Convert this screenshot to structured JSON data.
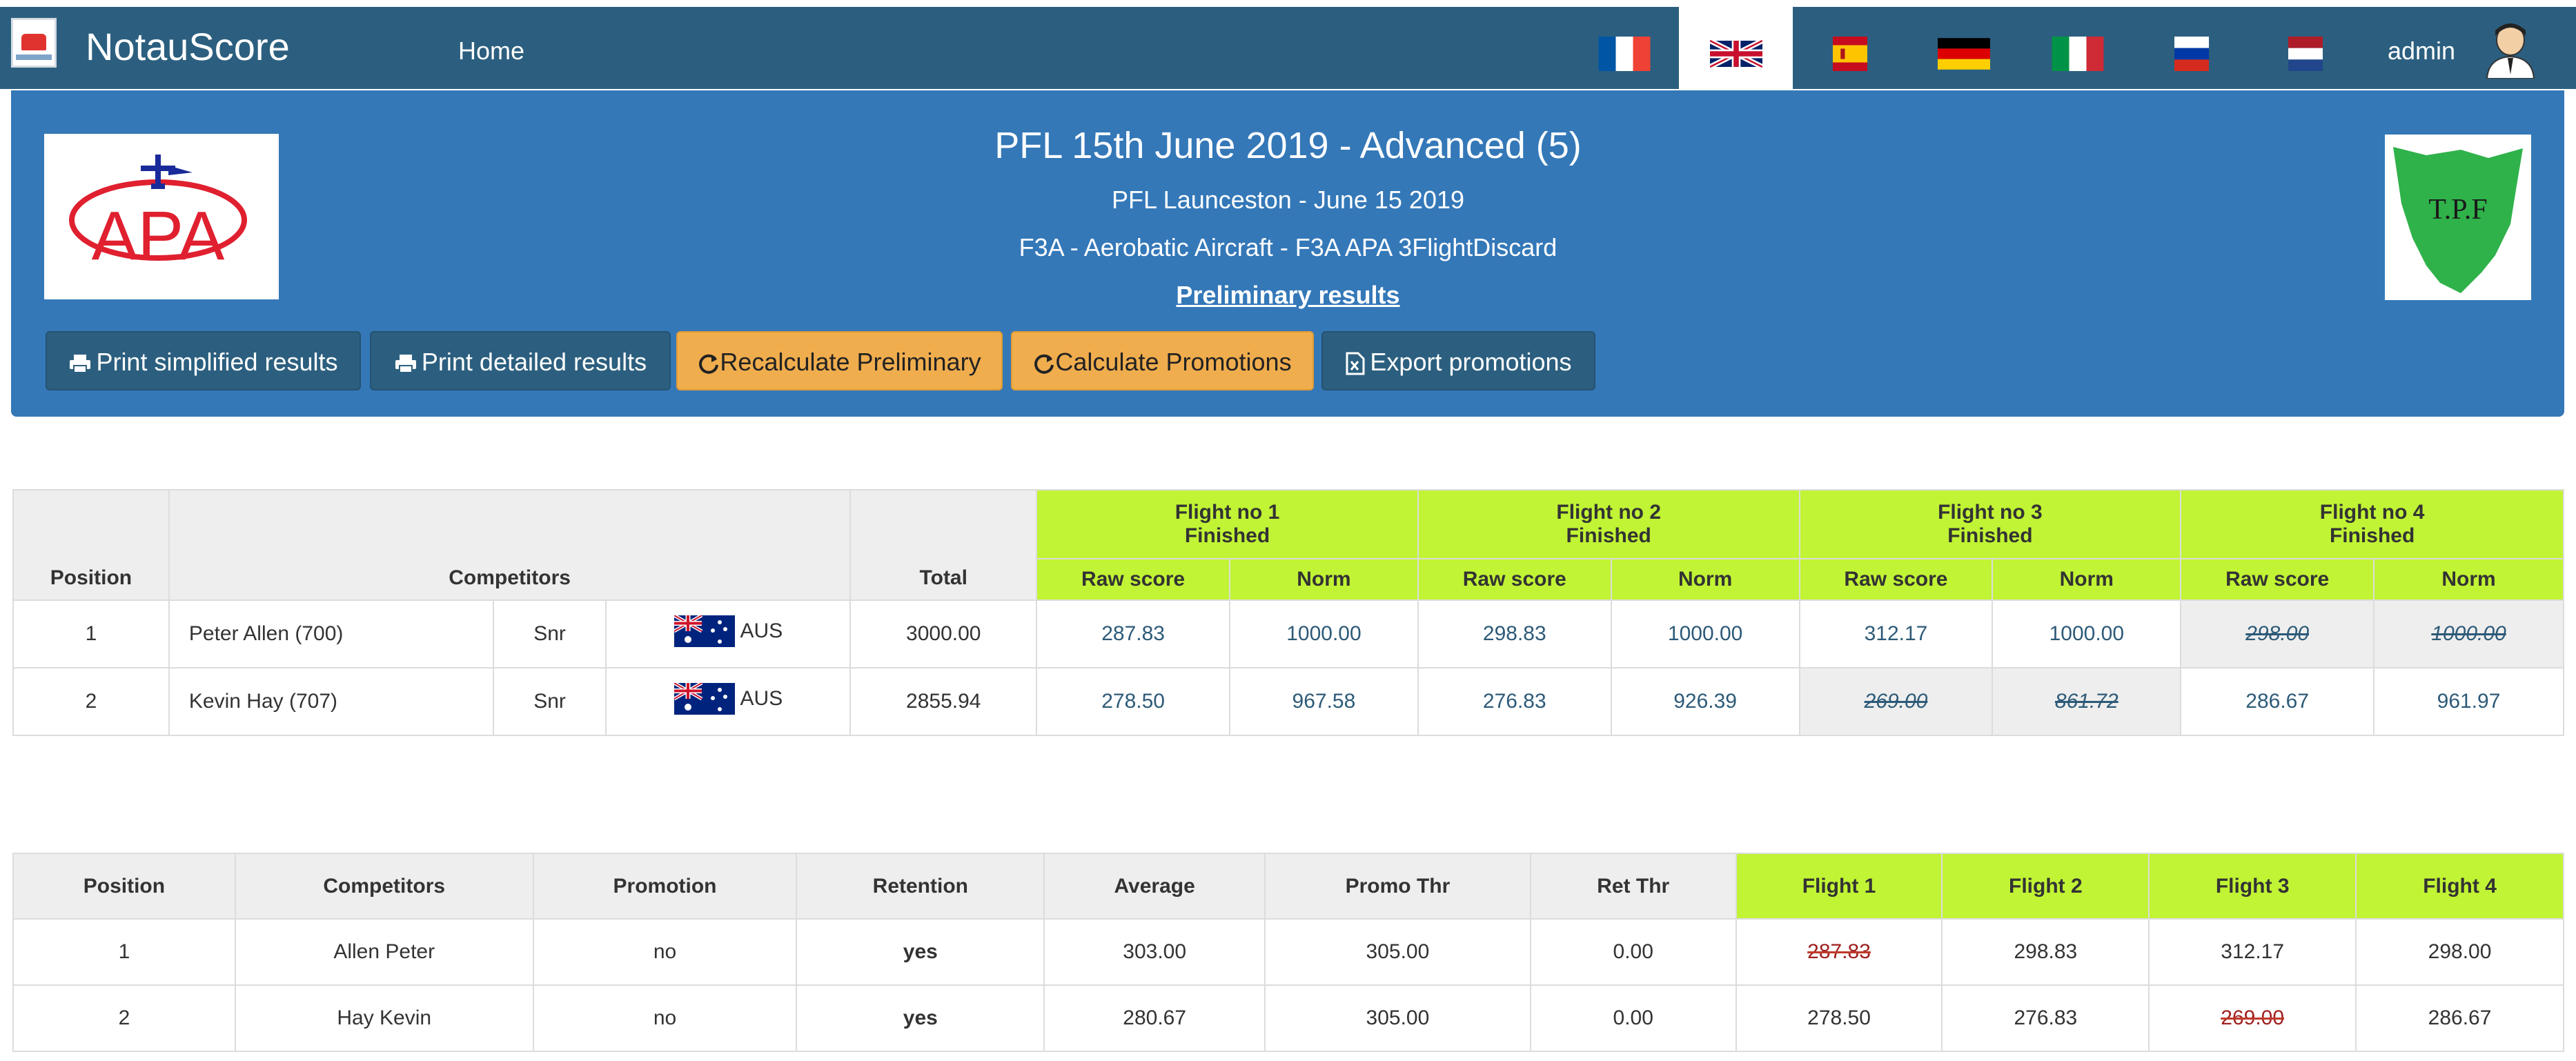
{
  "navbar": {
    "brand": "NotauScore",
    "home": "Home",
    "user": "admin",
    "flags": [
      "fr-flag-icon",
      "uk-flag-icon",
      "es-flag-icon",
      "de-flag-icon",
      "it-flag-icon",
      "ru-flag-icon",
      "nl-flag-icon"
    ],
    "active_flag": "uk-flag-icon"
  },
  "event": {
    "title": "PFL 15th June 2019 - Advanced (5)",
    "subtitle": "PFL Launceston - June 15 2019",
    "class": "F3A - Aerobatic Aircraft - F3A APA 3FlightDiscard",
    "preliminary": "Preliminary results",
    "left_logo_text": "APA",
    "right_logo_text": "T.P.F"
  },
  "buttons": {
    "print_simplified": "Print simplified results",
    "print_detailed": "Print detailed results",
    "recalc": "Recalculate Preliminary",
    "calc_promotions": "Calculate Promotions",
    "export_promotions": "Export promotions"
  },
  "results": {
    "headers": {
      "position": "Position",
      "competitors": "Competitors",
      "total": "Total",
      "raw": "Raw score",
      "norm": "Norm"
    },
    "flights": [
      {
        "name": "Flight no 1",
        "status": "Finished"
      },
      {
        "name": "Flight no 2",
        "status": "Finished"
      },
      {
        "name": "Flight no 3",
        "status": "Finished"
      },
      {
        "name": "Flight no 4",
        "status": "Finished"
      }
    ],
    "rows": [
      {
        "position": "1",
        "name": "Peter Allen (700)",
        "category": "Snr",
        "country": "AUS",
        "total": "3000.00",
        "scores": [
          {
            "raw": "287.83",
            "norm": "1000.00",
            "discarded": false
          },
          {
            "raw": "298.83",
            "norm": "1000.00",
            "discarded": false
          },
          {
            "raw": "312.17",
            "norm": "1000.00",
            "discarded": false
          },
          {
            "raw": "298.00",
            "norm": "1000.00",
            "discarded": true
          }
        ]
      },
      {
        "position": "2",
        "name": "Kevin Hay (707)",
        "category": "Snr",
        "country": "AUS",
        "total": "2855.94",
        "scores": [
          {
            "raw": "278.50",
            "norm": "967.58",
            "discarded": false
          },
          {
            "raw": "276.83",
            "norm": "926.39",
            "discarded": false
          },
          {
            "raw": "269.00",
            "norm": "861.72",
            "discarded": true
          },
          {
            "raw": "286.67",
            "norm": "961.97",
            "discarded": false
          }
        ]
      }
    ]
  },
  "promotions": {
    "headers": [
      "Position",
      "Competitors",
      "Promotion",
      "Retention",
      "Average",
      "Promo Thr",
      "Ret Thr",
      "Flight 1",
      "Flight 2",
      "Flight 3",
      "Flight 4"
    ],
    "rows": [
      {
        "position": "1",
        "name": "Allen Peter",
        "promotion": "no",
        "retention": "yes",
        "average": "303.00",
        "promo_thr": "305.00",
        "ret_thr": "0.00",
        "flights": [
          {
            "v": "287.83",
            "struck": true
          },
          {
            "v": "298.83",
            "struck": false
          },
          {
            "v": "312.17",
            "struck": false
          },
          {
            "v": "298.00",
            "struck": false
          }
        ]
      },
      {
        "position": "2",
        "name": "Hay Kevin",
        "promotion": "no",
        "retention": "yes",
        "average": "280.67",
        "promo_thr": "305.00",
        "ret_thr": "0.00",
        "flights": [
          {
            "v": "278.50",
            "struck": false
          },
          {
            "v": "276.83",
            "struck": false
          },
          {
            "v": "269.00",
            "struck": true
          },
          {
            "v": "286.67",
            "struck": false
          }
        ]
      }
    ]
  },
  "colors": {
    "navbar": "#2c5f7f",
    "panel": "#3478b8",
    "flight_header": "#c1f434",
    "warning_button": "#f0ad4e",
    "link_text": "#2d5a78"
  }
}
